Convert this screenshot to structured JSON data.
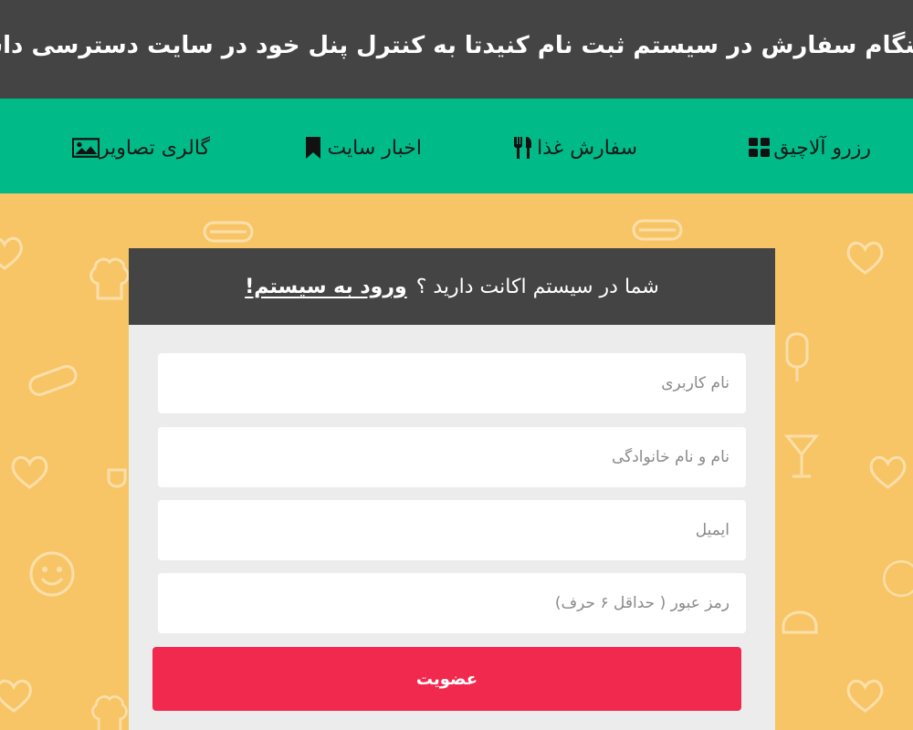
{
  "announcement": "هنگام سفارش در سیستم ثبت نام کنیدتا به کنترل پنل خود در سایت دسترسی داشته باشید",
  "nav": {
    "items": [
      {
        "label": "رزرو آلاچیق",
        "icon": "grid-icon"
      },
      {
        "label": "سفارش غذا",
        "icon": "utensils-icon"
      },
      {
        "label": "اخبار سایت",
        "icon": "bookmark-icon"
      },
      {
        "label": "گالری تصاویر",
        "icon": "image-icon"
      }
    ]
  },
  "register": {
    "prompt": "شما در سیستم اکانت دارید ؟",
    "login_link": "ورود به سیستم!",
    "fields": {
      "username_placeholder": "نام کاربری",
      "fullname_placeholder": "نام و نام خانوادگی",
      "email_placeholder": "ایمیل",
      "password_placeholder": "رمز عبور ( حداقل ۶ حرف)"
    },
    "submit_label": "عضویت"
  },
  "colors": {
    "topbar": "#444444",
    "nav": "#00bb88",
    "background": "#f8c566",
    "panel": "#ececec",
    "submit": "#f2294f"
  }
}
